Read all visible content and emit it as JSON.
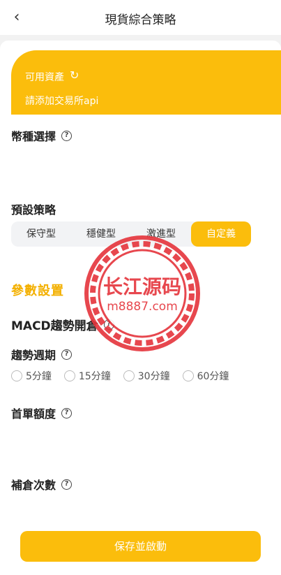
{
  "header": {
    "title": "現貨綜合策略",
    "back_icon": "chevron-left-icon"
  },
  "asset_card": {
    "label": "可用資產",
    "refresh_icon": "refresh-icon",
    "link": "請添加交易所api",
    "background_color": "#fbbd0c"
  },
  "sections": {
    "coin_selection": "幣種選擇",
    "preset_strategy": "預設策略",
    "param_settings": "參數設置",
    "macd": "MACD趨勢開倉",
    "trend_period": "趨勢週期",
    "first_order": "首單額度",
    "add_count": "補倉次數"
  },
  "strategy_tabs": [
    {
      "label": "保守型",
      "active": false
    },
    {
      "label": "穩健型",
      "active": false
    },
    {
      "label": "激進型",
      "active": false
    },
    {
      "label": "自定義",
      "active": true
    }
  ],
  "periods": [
    "5分鐘",
    "15分鐘",
    "30分鐘",
    "60分鐘"
  ],
  "save_button": "保存並啟動",
  "watermark": {
    "line1": "长江源码",
    "line2": "m8887.com"
  },
  "accent_color": "#fbbd0c"
}
